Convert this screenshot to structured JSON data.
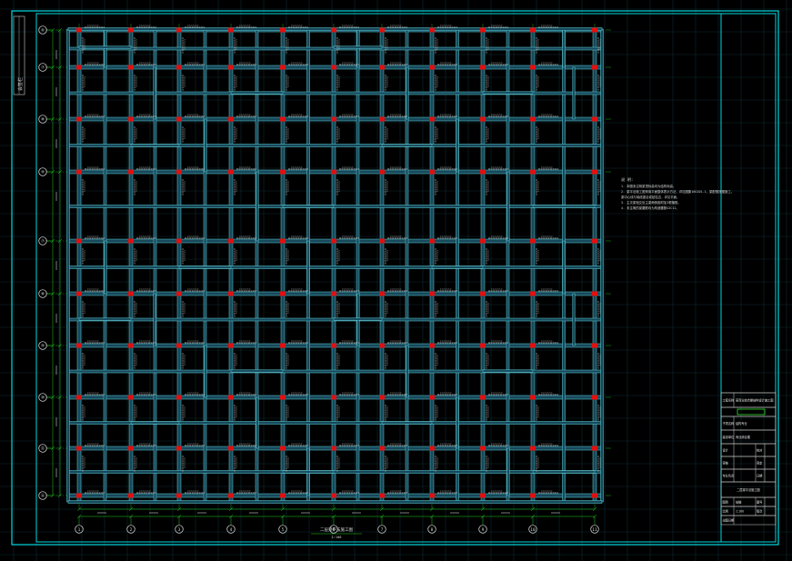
{
  "drawing": {
    "kind": "structural-beam-plan",
    "background": "#000000",
    "colors": {
      "background_grid": "#0e2a33",
      "frame": "#00d8e0",
      "beam_outline": "#5fd0d8",
      "beam_fill": "#17485a",
      "column": "#e01010",
      "axis_line": "#1fd01f",
      "dimension_line": "#1fd01f",
      "text": "#d8d8d8",
      "title_block_highlight": "#2fe02f"
    },
    "icons": {
      "axis_bubble": "circle-with-label-icon",
      "column_marker": "red-rectangle-icon"
    },
    "axes_rows": [
      "⑥",
      "⑦",
      "⑧",
      "⑨",
      "⑦",
      "⑧",
      "⑨",
      "⑩",
      "⑪",
      "Ⓐ"
    ],
    "axes_cols": [
      "①",
      "②",
      "③",
      "④",
      "⑤",
      "⑥",
      "⑦",
      "⑧",
      "⑨",
      "⑩",
      "⑪"
    ],
    "plan_caption": "二层梁平法施工图",
    "plan_scale": "1:100"
  },
  "notes": {
    "heading": "说 明:",
    "lines": [
      "1. 本图未注明梁顶标高均为结构标高。",
      "2. 梁平法施工图采用平面整体表示方法，详见图集16G101-1，梁配筋按图施工。",
      "   梁中心线与轴线重合或贴柱边，详见平面。",
      "3. 主次梁相交处主梁两侧各附加3根箍筋。",
      "4. 未注明的梁腰筋均为构造腰筋G2C12。"
    ]
  },
  "title_block": {
    "rows": [
      {
        "label": "工程名称",
        "value": "某商业综合楼结构设计施工图"
      },
      {
        "label": "",
        "value": ""
      },
      {
        "label": "子项名称",
        "value": "结构专业"
      },
      {
        "label": "建设单位",
        "value": "商业综合楼"
      },
      {
        "label": "设计",
        "value": "",
        "extra": "校对"
      },
      {
        "label": "审核",
        "value": "",
        "extra": "审定"
      },
      {
        "label": "专业负责",
        "value": "",
        "extra": "日期"
      },
      {
        "label": "",
        "value": "二层梁平法施工图"
      },
      {
        "label": "图别",
        "value": "结施",
        "extra": "图号"
      },
      {
        "label": "比例",
        "value": "1:100",
        "extra": "版次"
      },
      {
        "label": "出图日期",
        "value": ""
      }
    ]
  },
  "left_strip": {
    "label": "会签栏"
  }
}
